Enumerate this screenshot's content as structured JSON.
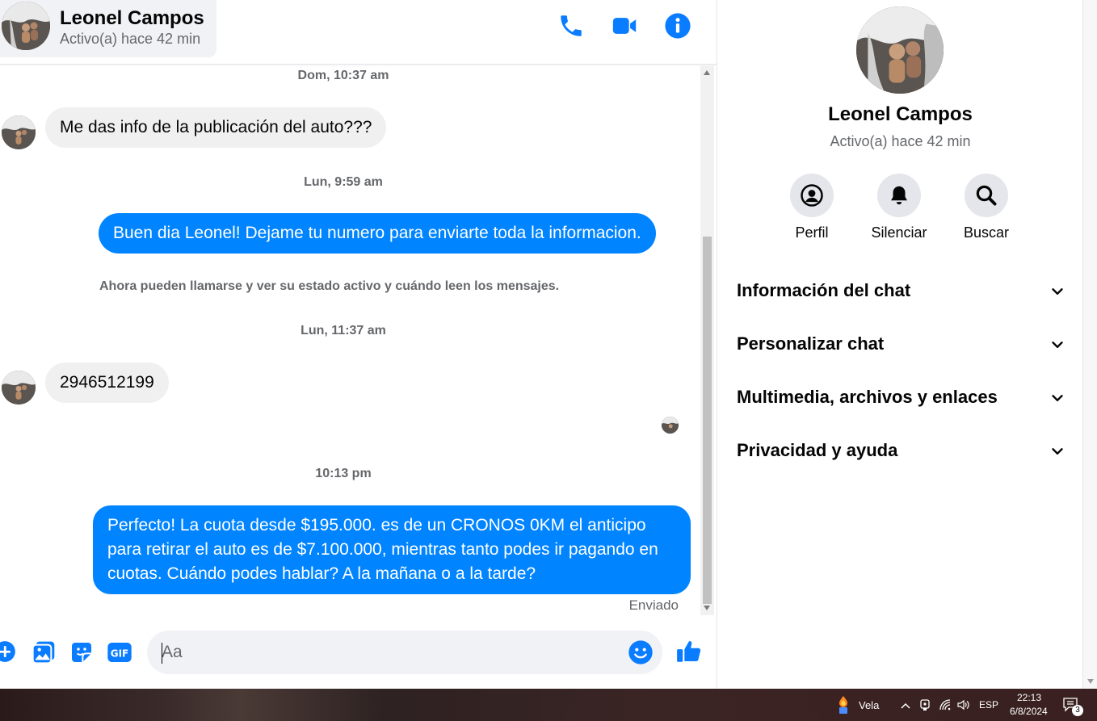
{
  "header": {
    "contact_name": "Leonel Campos",
    "contact_status": "Activo(a) hace 42 min",
    "icons": [
      "phone-icon",
      "video-camera-icon",
      "info-icon"
    ]
  },
  "conversation": {
    "separators": [
      "Dom, 10:37 am",
      "Lun, 9:59 am",
      "Lun, 11:37 am",
      "10:13 pm"
    ],
    "messages": [
      {
        "direction": "in",
        "text": "Me das info de la publicación del auto???"
      },
      {
        "direction": "out",
        "text": "Buen dia Leonel! Dejame tu numero para enviarte toda la informacion."
      },
      {
        "direction": "in",
        "text": "2946512199"
      },
      {
        "direction": "out",
        "text": "Perfecto! La cuota desde $195.000. es de un CRONOS 0KM el anticipo para retirar el auto es de $7.100.000, mientras tanto podes ir pagando en cuotas. Cuándo podes hablar? A la mañana o a la tarde?"
      }
    ],
    "system_note": "Ahora pueden llamarse y ver su estado activo y cuándo leen los mensajes.",
    "delivery_status": "Enviado"
  },
  "composer": {
    "placeholder": "Aa",
    "icons": [
      "plus-icon",
      "photo-icon",
      "sticker-icon",
      "gif-icon",
      "emoji-icon",
      "thumbs-up-icon"
    ],
    "gif_label": "GIF"
  },
  "profile_panel": {
    "name": "Leonel Campos",
    "status": "Activo(a) hace 42 min",
    "actions": [
      {
        "label": "Perfil",
        "icon": "profile-icon"
      },
      {
        "label": "Silenciar",
        "icon": "bell-icon"
      },
      {
        "label": "Buscar",
        "icon": "search-icon"
      }
    ],
    "sections": [
      "Información del chat",
      "Personalizar chat",
      "Multimedia, archivos y enlaces",
      "Privacidad y ayuda"
    ]
  },
  "taskbar": {
    "weather_app": "Vela",
    "language": "ESP",
    "time": "22:13",
    "date": "6/8/2024",
    "notification_count": "3"
  },
  "colors": {
    "accent": "#0084ff",
    "incoming_bubble": "#f0f0f0",
    "secondary_text": "#65676b"
  }
}
